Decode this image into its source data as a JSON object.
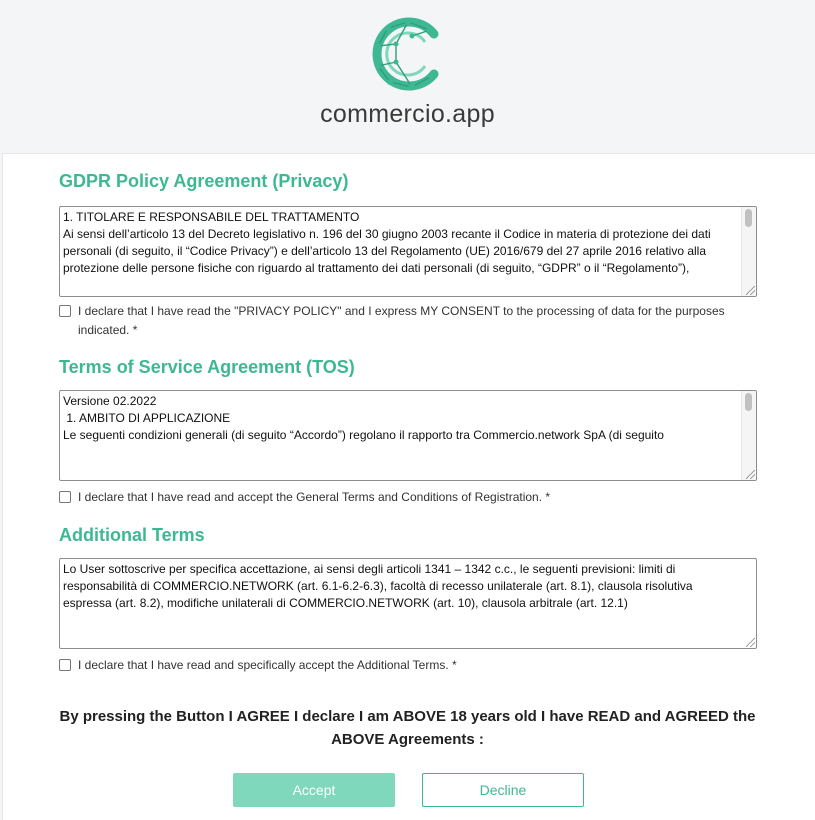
{
  "header": {
    "logo_icon": "commercio-c-network-logo",
    "logo_text": "commercio.app"
  },
  "colors": {
    "accent": "#3db892",
    "accept_button": "#7fd8bb",
    "header_bg": "#f4f5f6"
  },
  "privacy": {
    "title": "GDPR Policy Agreement (Privacy)",
    "text": [
      "1. TITOLARE E RESPONSABILE DEL TRATTAMENTO",
      "",
      "Ai sensi dell’articolo 13 del Decreto legislativo n. 196 del 30 giugno 2003 recante il Codice in materia di protezione dei dati personali (di seguito, il “Codice Privacy”) e dell’articolo 13 del Regolamento (UE) 2016/679 del 27 aprile 2016 relativo alla protezione delle persone fisiche con riguardo al trattamento dei dati personali (di seguito, “GDPR” o il “Regolamento”),"
    ],
    "consent_label": "I declare that I have read the \"PRIVACY POLICY\" and I express MY CONSENT to the processing of data for the purposes indicated. *"
  },
  "tos": {
    "title": "Terms of Service Agreement (TOS)",
    "text": [
      "Versione 02.2022",
      "",
      " 1. AMBITO DI APPLICAZIONE",
      "",
      "Le seguenti condizioni generali (di seguito “Accordo”) regolano il rapporto tra Commercio.network SpA (di seguito"
    ],
    "consent_label": "I declare that I have read and accept the General Terms and Conditions of Registration. *"
  },
  "additional": {
    "title": "Additional Terms",
    "text": [
      "Lo User sottoscrive per specifica accettazione, ai sensi degli articoli 1341 – 1342 c.c., le seguenti previsioni: limiti di responsabilità di COMMERCIO.NETWORK (art. 6.1-6.2-6.3), facoltà di recesso unilaterale (art. 8.1), clausola risolutiva espressa (art. 8.2), modifiche unilaterali di COMMERCIO.NETWORK (art. 10), clausola arbitrale (art. 12.1)"
    ],
    "consent_label": "I declare that I have read and specifically accept the Additional Terms. *"
  },
  "notice": "By pressing the Button I AGREE I declare I am ABOVE 18 years old I have READ and AGREED the ABOVE Agreements :",
  "buttons": {
    "accept": "Accept",
    "decline": "Decline"
  }
}
